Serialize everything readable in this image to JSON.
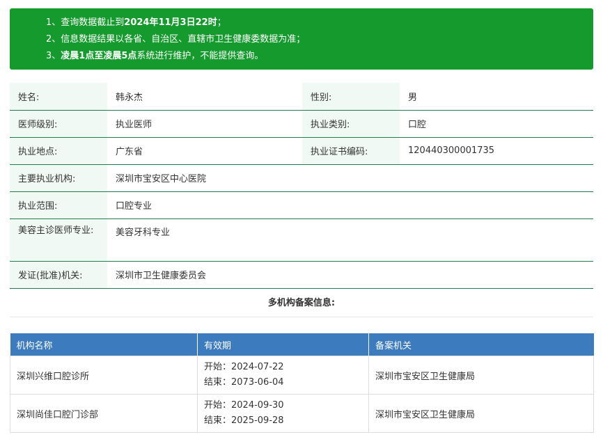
{
  "notice": {
    "line1_prefix": "1、查询数据截止到",
    "line1_bold": "2024年11月3日22时",
    "line1_suffix": "；",
    "line2": "2、信息数据结果以各省、自治区、直辖市卫生健康委数据为准；",
    "line3_prefix": "3、",
    "line3_bold": "凌晨1点至凌晨5点",
    "line3_suffix": "系统进行维护，不能提供查询。"
  },
  "info": {
    "name_label": "姓名:",
    "name_value": "韩永杰",
    "gender_label": "性别:",
    "gender_value": "男",
    "level_label": "医师级别:",
    "level_value": "执业医师",
    "category_label": "执业类别:",
    "category_value": "口腔",
    "location_label": "执业地点:",
    "location_value": "广东省",
    "cert_label": "执业证书编码:",
    "cert_value": "120440300001735",
    "institution_label": "主要执业机构:",
    "institution_value": "深圳市宝安区中心医院",
    "scope_label": "执业范围:",
    "scope_value": "口腔专业",
    "cosmetic_label": "美容主诊医师专业:",
    "cosmetic_value": "美容牙科专业",
    "issuer_label": "发证(批准)机关:",
    "issuer_value": "深圳市卫生健康委员会"
  },
  "multi_title": "多机构备案信息:",
  "institutions": {
    "headers": [
      "机构名称",
      "有效期",
      "备案机关"
    ],
    "rows": [
      {
        "name": "深圳兴维口腔诊所",
        "start": "开始：2024-07-22",
        "end": "结束：2073-06-04",
        "authority": "深圳市宝安区卫生健康局"
      },
      {
        "name": "深圳尚佳口腔门诊部",
        "start": "开始：2024-09-30",
        "end": "结束：2025-09-28",
        "authority": "深圳市宝安区卫生健康局"
      }
    ]
  },
  "colors": {
    "notice_bg": "#159b2d",
    "table_header_bg": "#3c7bbd",
    "label_bg": "#f0f9f4",
    "row_border": "#1f7a4c"
  }
}
